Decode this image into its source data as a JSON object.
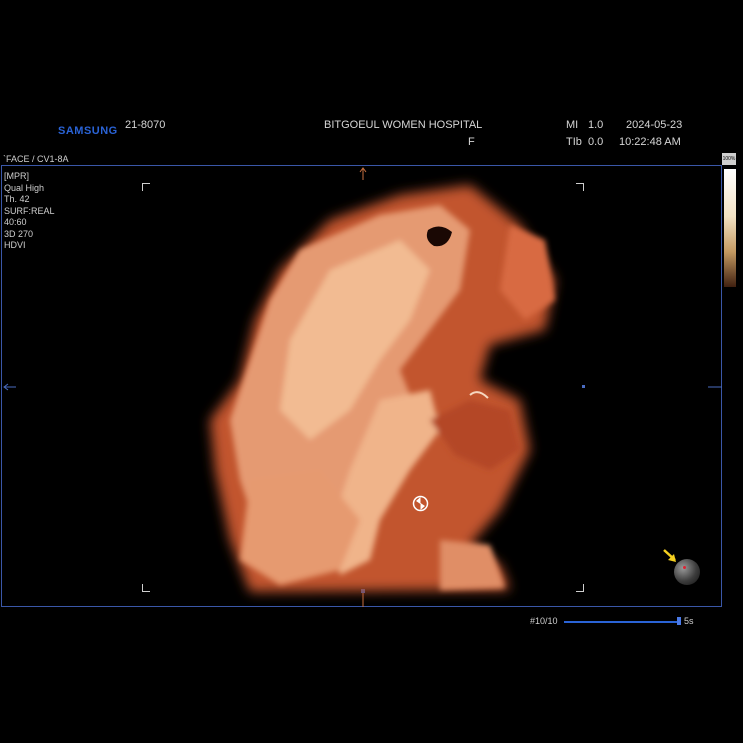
{
  "header": {
    "brand": "SAMSUNG",
    "patient_id": "21-8070",
    "hospital": "BITGOEUL WOMEN HOSPITAL",
    "sub_label": "F",
    "mi_label": "MI",
    "mi_value": "1.0",
    "tib_label": "TIb",
    "tib_value": "0.0",
    "date": "2024-05-23",
    "time": "10:22:48 AM"
  },
  "probe_preset": "`FACE / CV1-8A",
  "params": [
    "[MPR]",
    "Qual High",
    "Th. 42",
    "SURF:REAL",
    "40:60",
    "3D 270",
    "HDVI"
  ],
  "grayscale_bar_label": "100%",
  "cine": {
    "frame": "#10/10",
    "duration": "5s"
  },
  "colors": {
    "brand": "#2a63d6",
    "frame_border": "#3a57a8",
    "render_skin": "#e8a47a",
    "arrow": "#f5d020"
  },
  "icons": {
    "rotate": "rotate-icon",
    "orientation_sphere": "orientation-sphere-icon",
    "pointer_arrow": "arrow-icon"
  }
}
